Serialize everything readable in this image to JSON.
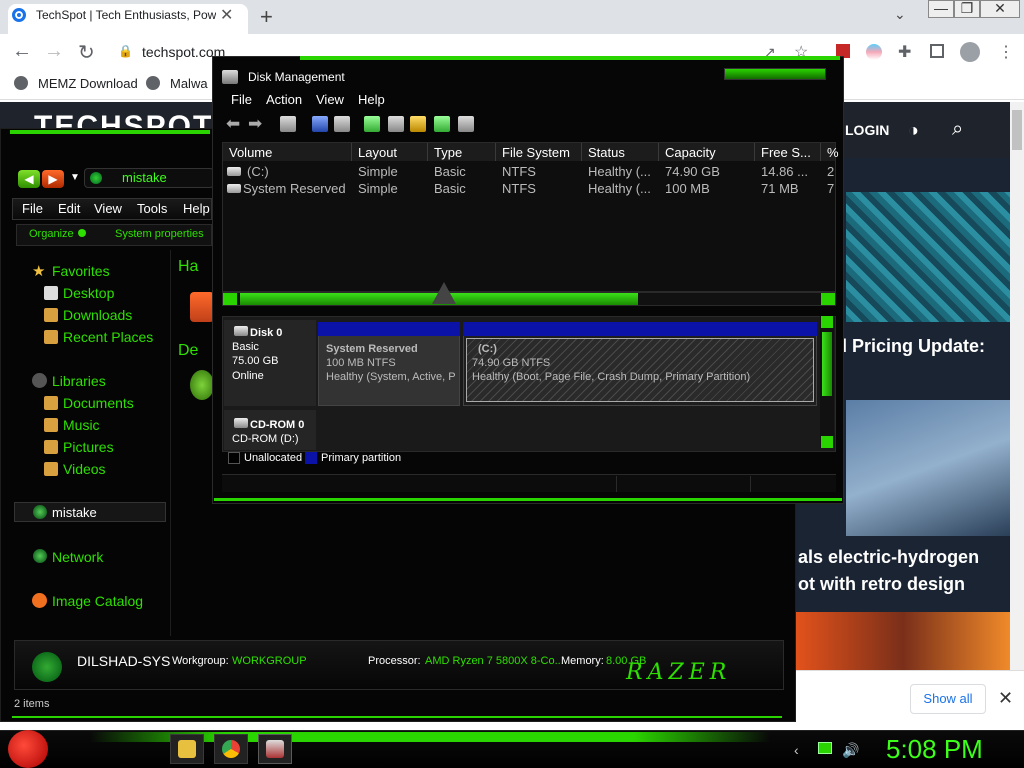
{
  "browser": {
    "tab_title": "TechSpot | Tech Enthusiasts, Pow",
    "url": "techspot.com",
    "bookmarks": [
      "MEMZ Download",
      "Malwa"
    ],
    "site": {
      "login": "LOGIN",
      "headline1": "d Pricing Update:",
      "headline2_line1": "als electric-hydrogen",
      "headline2_line2": "ot with retro design",
      "show_all": "Show all"
    }
  },
  "explorer": {
    "address": "mistake",
    "menu": [
      "File",
      "Edit",
      "View",
      "Tools",
      "Help"
    ],
    "commands": [
      "Organize",
      "System properties"
    ],
    "nav": {
      "favorites": "Favorites",
      "desktop": "Desktop",
      "downloads": "Downloads",
      "recent": "Recent Places",
      "libraries": "Libraries",
      "documents": "Documents",
      "music": "Music",
      "pictures": "Pictures",
      "videos": "Videos",
      "homegroup": "mistake",
      "network": "Network",
      "image_catalog": "Image Catalog"
    },
    "group_hard": "Ha",
    "group_dev": "De",
    "details": {
      "pc_name": "DILSHAD-SYS",
      "workgroup_label": "Workgroup:",
      "workgroup": "WORKGROUP",
      "processor_label": "Processor:",
      "processor": "AMD Ryzen 7 5800X 8-Co...",
      "memory_label": "Memory:",
      "memory": "8.00 GB",
      "brand": "RAZER"
    },
    "status": "2 items"
  },
  "disk_mgmt": {
    "title": "Disk Management",
    "menu": [
      "File",
      "Action",
      "View",
      "Help"
    ],
    "columns": [
      "Volume",
      "Layout",
      "Type",
      "File System",
      "Status",
      "Capacity",
      "Free S...",
      "%"
    ],
    "rows": [
      [
        "(C:)",
        "Simple",
        "Basic",
        "NTFS",
        "Healthy (...",
        "74.90 GB",
        "14.86 ...",
        "2"
      ],
      [
        "System Reserved",
        "Simple",
        "Basic",
        "NTFS",
        "Healthy (...",
        "100 MB",
        "71 MB",
        "7"
      ]
    ],
    "disk0": {
      "name": "Disk 0",
      "type": "Basic",
      "size": "75.00 GB",
      "state": "Online"
    },
    "partitions": {
      "sr_title": "System Reserved",
      "sr_size": "100 MB NTFS",
      "sr_status": "Healthy (System, Active, P",
      "c_title": "(C:)",
      "c_size": "74.90 GB NTFS",
      "c_status": "Healthy (Boot, Page File, Crash Dump, Primary Partition)"
    },
    "cdrom": {
      "name": "CD-ROM 0",
      "label": "CD-ROM (D:)"
    },
    "legend": [
      "Unallocated",
      "Primary partition"
    ]
  },
  "taskbar": {
    "clock": "5:08 PM"
  },
  "colors": {
    "accent": "#2ad400",
    "primary_partition": "#0a12a8",
    "text_green": "#2ee000"
  }
}
